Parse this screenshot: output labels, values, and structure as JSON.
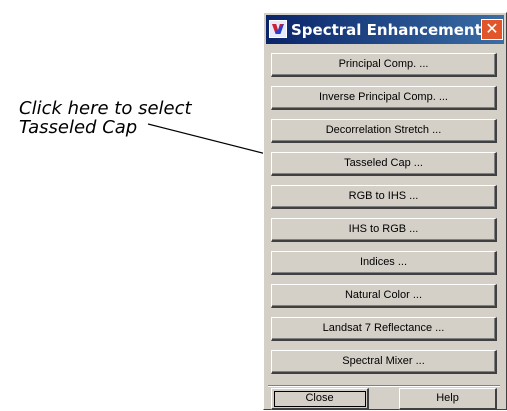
{
  "callout": {
    "line1": "Click here to select",
    "line2": "Tasseled Cap"
  },
  "window": {
    "title": "Spectral Enhancement",
    "app_icon": "erdas-icon",
    "close_icon": "close-icon",
    "close_glyph": "✕"
  },
  "buttons": [
    {
      "label": "Principal Comp. ..."
    },
    {
      "label": "Inverse Principal Comp. ..."
    },
    {
      "label": "Decorrelation Stretch ..."
    },
    {
      "label": "Tasseled Cap ..."
    },
    {
      "label": "RGB to IHS ..."
    },
    {
      "label": "IHS to RGB ..."
    },
    {
      "label": "Indices ..."
    },
    {
      "label": "Natural Color ..."
    },
    {
      "label": "Landsat 7 Reflectance ..."
    },
    {
      "label": "Spectral Mixer ..."
    }
  ],
  "footer": {
    "close_label": "Close",
    "help_label": "Help"
  },
  "colors": {
    "titlebar_start": "#0a246a",
    "titlebar_end": "#3a6ea5",
    "face": "#d4d0c8",
    "close_button": "#e0552a"
  }
}
